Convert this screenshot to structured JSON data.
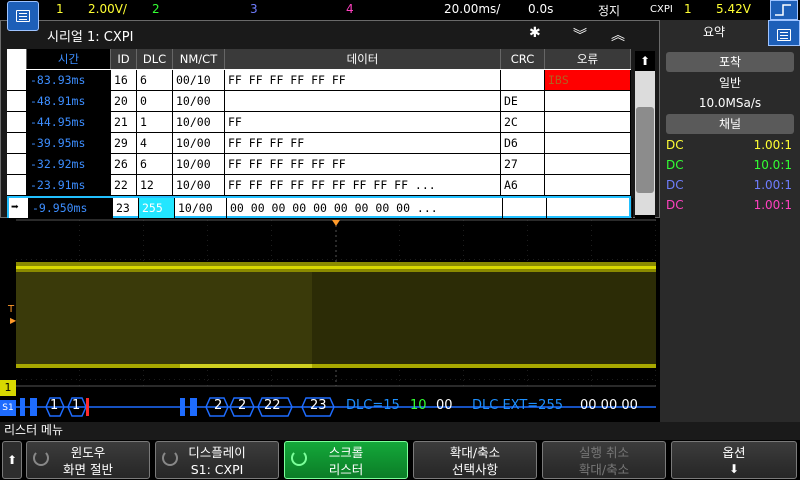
{
  "topbar": {
    "ch1_num": "1",
    "ch1_scale": "2.00V/",
    "ch2_num": "2",
    "ch3_num": "3",
    "ch4_num": "4",
    "timebase": "20.00ms/",
    "delay": "0.0s",
    "run_state": "정지",
    "trigger_type": "CXPI",
    "trigger_source": "1",
    "trigger_level": "5.42V"
  },
  "lister": {
    "title": "시리얼 1: CXPI",
    "columns": [
      "시간",
      "ID",
      "DLC",
      "NM/CT",
      "데이터",
      "CRC",
      "오류"
    ],
    "rows": [
      {
        "time": "-83.93ms",
        "id": "16",
        "dlc": "6",
        "nmct": "00/10",
        "data": "FF FF FF FF FF FF",
        "crc": "",
        "error": "IBS"
      },
      {
        "time": "-48.91ms",
        "id": "20",
        "dlc": "0",
        "nmct": "10/00",
        "data": "",
        "crc": "DE",
        "error": ""
      },
      {
        "time": "-44.95ms",
        "id": "21",
        "dlc": "1",
        "nmct": "10/00",
        "data": "FF",
        "crc": "2C",
        "error": ""
      },
      {
        "time": "-39.95ms",
        "id": "29",
        "dlc": "4",
        "nmct": "10/00",
        "data": "FF FF FF FF",
        "crc": "D6",
        "error": ""
      },
      {
        "time": "-32.92ms",
        "id": "26",
        "dlc": "6",
        "nmct": "10/00",
        "data": "FF FF FF FF FF FF",
        "crc": "27",
        "error": ""
      },
      {
        "time": "-23.91ms",
        "id": "22",
        "dlc": "12",
        "nmct": "10/00",
        "data": "FF FF FF FF FF FF FF FF FF ...",
        "crc": "A6",
        "error": ""
      },
      {
        "time": "-9.950ms",
        "id": "23",
        "dlc": "255",
        "nmct": "10/00",
        "data": "00 00 00 00 00 00 00 00 00 ...",
        "crc": "",
        "error": ""
      }
    ]
  },
  "decode": {
    "ch_marker": "1",
    "trig_marker": "T",
    "serial_marker": "S1",
    "seg1": "1",
    "seg2": "1",
    "seg3": "2",
    "seg4": "2",
    "seg5": "22",
    "seg6": "23",
    "dlc_label": "DLC=15",
    "val10": "10",
    "val00": "00",
    "dlc_ext_label": "DLC EXT=255",
    "tail": "00 00 00"
  },
  "side": {
    "tab_label": "요약",
    "acq_header": "포착",
    "acq_mode": "일반",
    "sample_rate": "10.0MSa/s",
    "ch_header": "채널",
    "channels": [
      {
        "coupling": "DC",
        "ratio": "1.00:1",
        "color": "#ffff33"
      },
      {
        "coupling": "DC",
        "ratio": "10.0:1",
        "color": "#33ff33"
      },
      {
        "coupling": "DC",
        "ratio": "1.00:1",
        "color": "#6f7dff"
      },
      {
        "coupling": "DC",
        "ratio": "1.00:1",
        "color": "#ff40c0"
      }
    ]
  },
  "menu": {
    "title": "리스터 메뉴",
    "keys": [
      {
        "line1": "윈도우",
        "line2": "화면 절반"
      },
      {
        "line1": "디스플레이",
        "line2": "S1: CXPI"
      },
      {
        "line1": "스크롤",
        "line2": "리스터"
      },
      {
        "line1": "확대/축소",
        "line2": "선택사항"
      },
      {
        "line1": "실행 취소",
        "line2": "확대/축소"
      },
      {
        "line1": "옵션",
        "line2": ""
      }
    ]
  },
  "colors": {
    "ch1": "#ffff33",
    "ch2": "#33ff33",
    "ch3": "#6f7dff",
    "ch4": "#ff40c0",
    "decode_blue": "#1e6cff",
    "active_key": "#14a83a",
    "error_red": "#ff0000"
  }
}
